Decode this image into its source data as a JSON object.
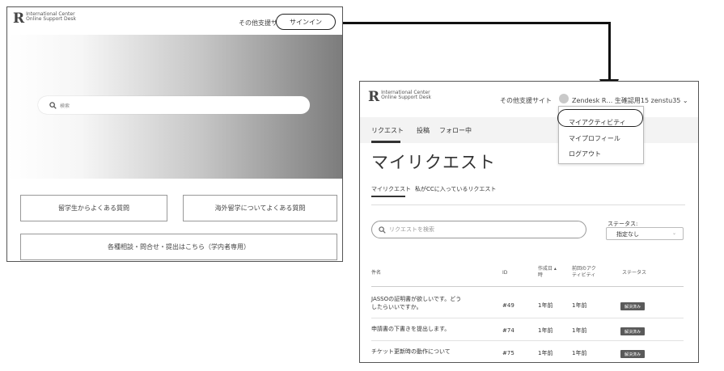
{
  "left_screen": {
    "logo": {
      "mark": "R",
      "line1": "International Center",
      "line2": "Online Support Desk"
    },
    "other_sites_link": "その他支援サイト",
    "signin_button": "サインイン",
    "search": {
      "placeholder": "検索",
      "icon": "search-icon"
    },
    "buttons": {
      "faq_students": "留学生からよくある質問",
      "faq_abroad": "海外留学についてよくある質問",
      "consult": "各種相談・問合せ・提出はこちら（学内者専用）"
    }
  },
  "right_screen": {
    "logo": {
      "mark": "R",
      "line1": "International Center",
      "line2": "Online Support Desk"
    },
    "other_sites_link": "その他支援サイト",
    "user_name": "Zendesk R… 生確認用15 zenstu35 ⌄",
    "user_menu": [
      "マイアクティビティ",
      "マイプロフィール",
      "ログアウト"
    ],
    "nav_tabs": [
      "リクエスト",
      "投稿",
      "フォロー中"
    ],
    "page_title": "マイリクエスト",
    "sub_tabs": [
      "マイリクエスト",
      "私がCCに入っているリクエスト"
    ],
    "search_placeholder": "リクエストを検索",
    "status_filter": {
      "label": "ステータス:",
      "value": "指定なし",
      "chevron": "⌄"
    },
    "table": {
      "headers": {
        "subject": "件名",
        "id": "ID",
        "created": "作成日 ▴\n時",
        "last_activity": "前回のアク\nティビティ",
        "status": "ステータス"
      },
      "rows": [
        {
          "subject": "JASSOの証明書が欲しいです。どう\nしたらいいですか。",
          "id": "#49",
          "created": "1年前",
          "last_activity": "1年前",
          "status": "解決済み"
        },
        {
          "subject": "申請書の下書きを提出します。",
          "id": "#74",
          "created": "1年前",
          "last_activity": "1年前",
          "status": "解決済み"
        },
        {
          "subject": "チケット更新時の動作について",
          "id": "#75",
          "created": "1年前",
          "last_activity": "1年前",
          "status": "解決済み"
        }
      ]
    }
  },
  "colors": {
    "highlight_ring": "#222222",
    "badge": "#5a5a5a",
    "arrow": "#111111"
  }
}
